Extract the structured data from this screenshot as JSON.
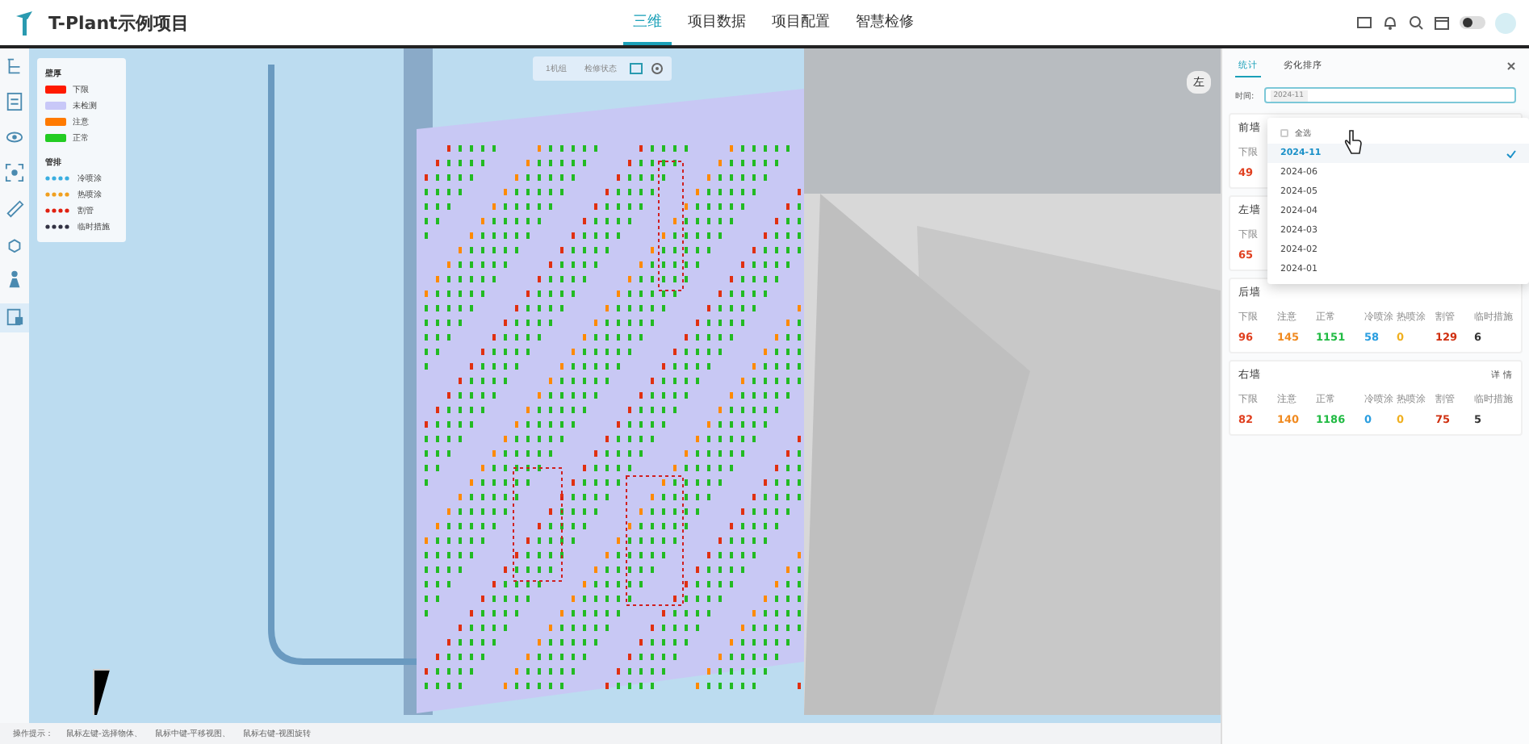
{
  "header": {
    "title": "T-Plant示例项目",
    "nav": [
      {
        "label": "三维",
        "selected": true
      },
      {
        "label": "项目数据",
        "selected": false
      },
      {
        "label": "项目配置",
        "selected": false
      },
      {
        "label": "智慧检修",
        "selected": false
      }
    ],
    "theme_toggle": {
      "on": false
    }
  },
  "toolbar": {
    "items": [
      {
        "selected": false
      },
      {
        "selected": false
      },
      {
        "selected": false
      },
      {
        "selected": false
      },
      {
        "selected": false
      },
      {
        "selected": false
      },
      {
        "selected": false
      },
      {
        "selected": true
      }
    ]
  },
  "viewport": {
    "unit_select": "1机组",
    "status_select": "检修状态",
    "orientation_label": "左",
    "legend": [
      {
        "title": "壁厚",
        "items": [
          {
            "kind": "swatch",
            "label": "下限",
            "color": "#ff1a00"
          },
          {
            "kind": "swatch",
            "label": "未检测",
            "color": "#c8c8f8"
          },
          {
            "kind": "swatch",
            "label": "注意",
            "color": "#ff7a00"
          },
          {
            "kind": "swatch",
            "label": "正常",
            "color": "#22cc22"
          }
        ]
      },
      {
        "title": "管排",
        "items": [
          {
            "kind": "dots",
            "label": "冷喷涂",
            "color": "#3aaee0"
          },
          {
            "kind": "dots",
            "label": "热喷涂",
            "color": "#f0a020"
          },
          {
            "kind": "dots",
            "label": "割管",
            "color": "#e02010"
          },
          {
            "kind": "dots",
            "label": "临时措施",
            "color": "#333344"
          }
        ]
      }
    ]
  },
  "status_bar": {
    "label": "操作提示：",
    "hints": [
      "鼠标左键-选择物体、",
      "鼠标中键-平移视图、",
      "鼠标右键-视图旋转"
    ]
  },
  "panel": {
    "tabs": [
      {
        "label": "统计",
        "selected": true
      },
      {
        "label": "劣化排序",
        "selected": false
      }
    ],
    "time_label": "时间:",
    "time_tags": [
      "2024-11"
    ],
    "dropdown": {
      "select_all": {
        "label": "全选",
        "checked": false
      },
      "options": [
        {
          "label": "2024-11",
          "selected": true
        },
        {
          "label": "2024-06",
          "selected": false
        },
        {
          "label": "2024-05",
          "selected": false
        },
        {
          "label": "2024-04",
          "selected": false
        },
        {
          "label": "2024-03",
          "selected": false
        },
        {
          "label": "2024-02",
          "selected": false
        },
        {
          "label": "2024-01",
          "selected": false
        }
      ]
    },
    "cards": [
      {
        "title": "前墙",
        "stats": [
          {
            "label": "下限",
            "value": "49",
            "color": "#e04020"
          }
        ]
      },
      {
        "title": "左墙",
        "stats": [
          {
            "label": "下限",
            "value": "65",
            "color": "#e04020"
          }
        ]
      },
      {
        "title": "后墙",
        "stats": [
          {
            "label": "下限",
            "value": "96",
            "color": "#e04020"
          },
          {
            "label": "注意",
            "value": "145",
            "color": "#f08a20"
          },
          {
            "label": "正常",
            "value": "1151",
            "color": "#22bb44"
          },
          {
            "label": "冷喷涂",
            "value": "58",
            "color": "#2a9ee0"
          },
          {
            "label": "热喷涂",
            "value": "0",
            "color": "#f0b020"
          },
          {
            "label": "割管",
            "value": "129",
            "color": "#d03010"
          },
          {
            "label": "临时措施",
            "value": "6",
            "color": "#333333"
          }
        ]
      },
      {
        "title": "右墙",
        "detail": "详 情",
        "stats": [
          {
            "label": "下限",
            "value": "82",
            "color": "#e04020"
          },
          {
            "label": "注意",
            "value": "140",
            "color": "#f08a20"
          },
          {
            "label": "正常",
            "value": "1186",
            "color": "#22bb44"
          },
          {
            "label": "冷喷涂",
            "value": "0",
            "color": "#2a9ee0"
          },
          {
            "label": "热喷涂",
            "value": "0",
            "color": "#f0b020"
          },
          {
            "label": "割管",
            "value": "75",
            "color": "#d03010"
          },
          {
            "label": "临时措施",
            "value": "5",
            "color": "#333333"
          }
        ]
      }
    ]
  }
}
